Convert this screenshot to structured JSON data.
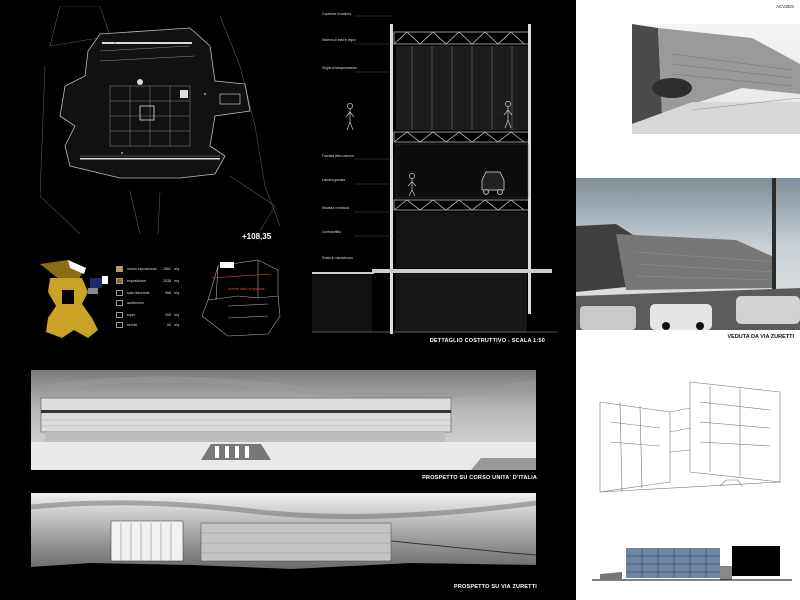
{
  "sheet": {
    "code": "ACVZES",
    "elevation_mark": "+108,35",
    "detail_caption": "DETTAGLIO COSTRUTTIVO -  SCALA 1:50",
    "view_caption": "VEDUTA DA VIA ZURETTI",
    "elevation1_caption": "PROSPETTO SU CORSO UNITA' D'ITALIA",
    "elevation2_caption": "PROSPETTO SU VIA ZURETTI",
    "key_label": "schema della ricognizione"
  },
  "legend": [
    {
      "name": "nuova esposizione",
      "value": "1581",
      "unit": "mq",
      "color": "#c9a227"
    },
    {
      "name": "esposizione",
      "value": "2038",
      "unit": "mq",
      "color": "#8a6d14"
    },
    {
      "name": "sala ristorante",
      "value": "986",
      "unit": "mq",
      "color": "#000000"
    },
    {
      "name": "auditorium",
      "value": "",
      "unit": "",
      "color": "#000000"
    },
    {
      "name": "foyer",
      "value": "200",
      "unit": "mq",
      "color": "#000000"
    },
    {
      "name": "servizi",
      "value": "50",
      "unit": "mq",
      "color": "#000000"
    }
  ],
  "section_notes": [
    "Copertura in lamiera",
    "Sistema di travi in legno",
    "Griglia di tamponamento",
    "Facciata vetro-camera",
    "Lamiera grecata",
    "Struttura in traliccio",
    "Controsoffitto",
    "Solaio in calcestruzzo"
  ],
  "colors": {
    "background": "#000000",
    "panel": "#ffffff",
    "accent_gold": "#c9a227",
    "accent_red": "#c0392b",
    "facade_blue": "#6d86a6"
  }
}
